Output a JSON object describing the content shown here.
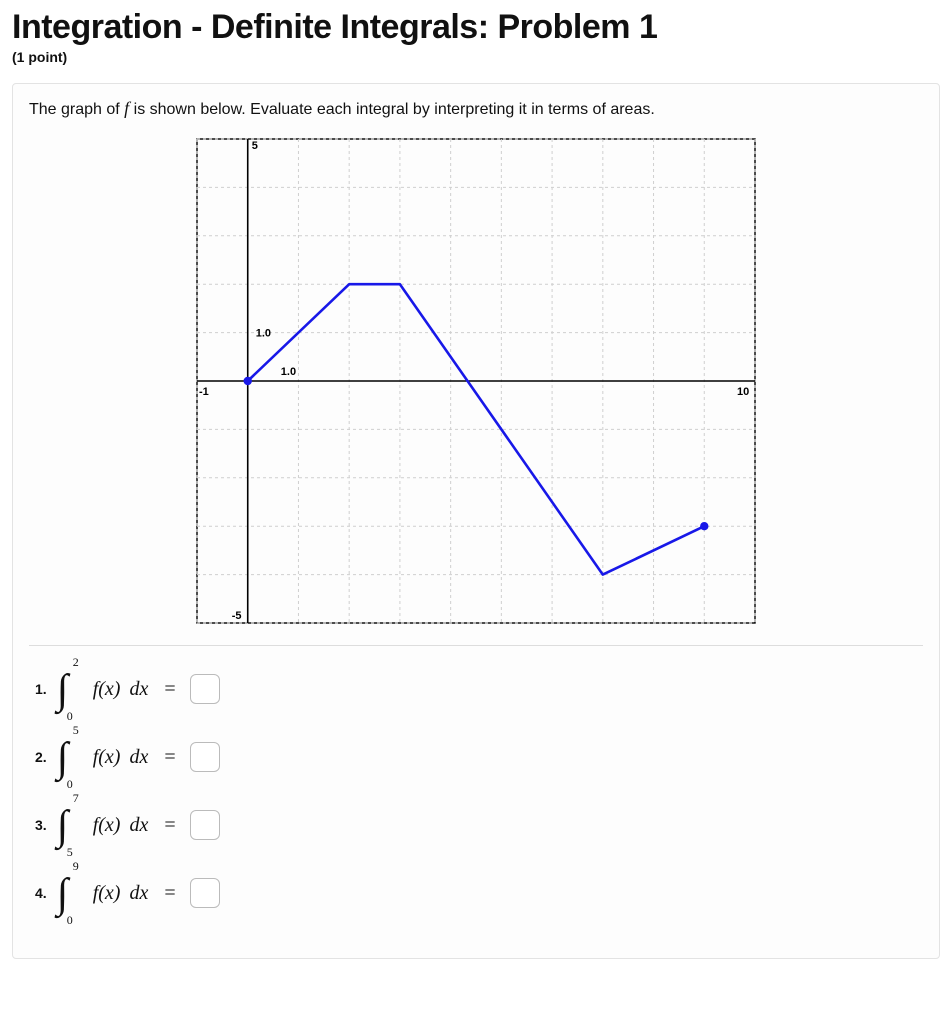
{
  "title": "Integration - Definite Integrals: Problem 1",
  "points": "(1 point)",
  "prompt_pre": "The graph of ",
  "prompt_var": "f",
  "prompt_post": " is shown below. Evaluate each integral by interpreting it in terms of areas.",
  "questions": [
    {
      "num": "1.",
      "lower": "0",
      "upper": "2",
      "integrand": "f(x)",
      "dx": "dx",
      "eq": "=",
      "value": ""
    },
    {
      "num": "2.",
      "lower": "0",
      "upper": "5",
      "integrand": "f(x)",
      "dx": "dx",
      "eq": "=",
      "value": ""
    },
    {
      "num": "3.",
      "lower": "5",
      "upper": "7",
      "integrand": "f(x)",
      "dx": "dx",
      "eq": "=",
      "value": ""
    },
    {
      "num": "4.",
      "lower": "0",
      "upper": "9",
      "integrand": "f(x)",
      "dx": "dx",
      "eq": "=",
      "value": ""
    }
  ],
  "chart_data": {
    "type": "line",
    "x": [
      0,
      2,
      3,
      7,
      9
    ],
    "y": [
      0,
      2,
      2,
      -4,
      -3
    ],
    "xlim": [
      -1,
      10
    ],
    "ylim": [
      -5,
      5
    ],
    "x_ticks": [
      -1,
      10
    ],
    "y_ticks": [
      -5,
      5
    ],
    "point_labels": [
      {
        "x": 0,
        "y": 1,
        "text": "1.0"
      },
      {
        "x": 1,
        "y": 0,
        "text": "1.0"
      }
    ],
    "endpoint_markers": [
      {
        "x": 0,
        "y": 0
      },
      {
        "x": 9,
        "y": -3
      }
    ],
    "grid": true,
    "line_color": "#1818e8",
    "axis_color": "#000000",
    "grid_color": "#cfcfcf"
  }
}
